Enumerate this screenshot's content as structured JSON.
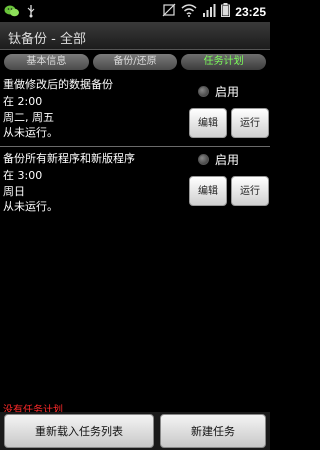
{
  "statusbar": {
    "time": "23:25",
    "icons": [
      "wechat-icon",
      "usb-icon",
      "muted-icon",
      "wifi-icon",
      "signal-icon",
      "battery-icon"
    ]
  },
  "app": {
    "title": "钛备份 - 全部"
  },
  "tabs": [
    {
      "label": "基本信息",
      "active": false
    },
    {
      "label": "备份/还原",
      "active": false
    },
    {
      "label": "任务计划",
      "active": true
    }
  ],
  "tasks": [
    {
      "title": "重做修改后的数据备份",
      "time": "在 2:00",
      "days": "周二, 周五",
      "status": "从未运行。",
      "toggle_label": "启用",
      "edit_label": "编辑",
      "run_label": "运行"
    },
    {
      "title": "备份所有新程序和新版程序",
      "time": "在 3:00",
      "days": "周日",
      "status": "从未运行。",
      "toggle_label": "启用",
      "edit_label": "编辑",
      "run_label": "运行"
    }
  ],
  "footer": {
    "empty_text": "没有任务计划",
    "reload_label": "重新载入任务列表",
    "new_label": "新建任务"
  }
}
